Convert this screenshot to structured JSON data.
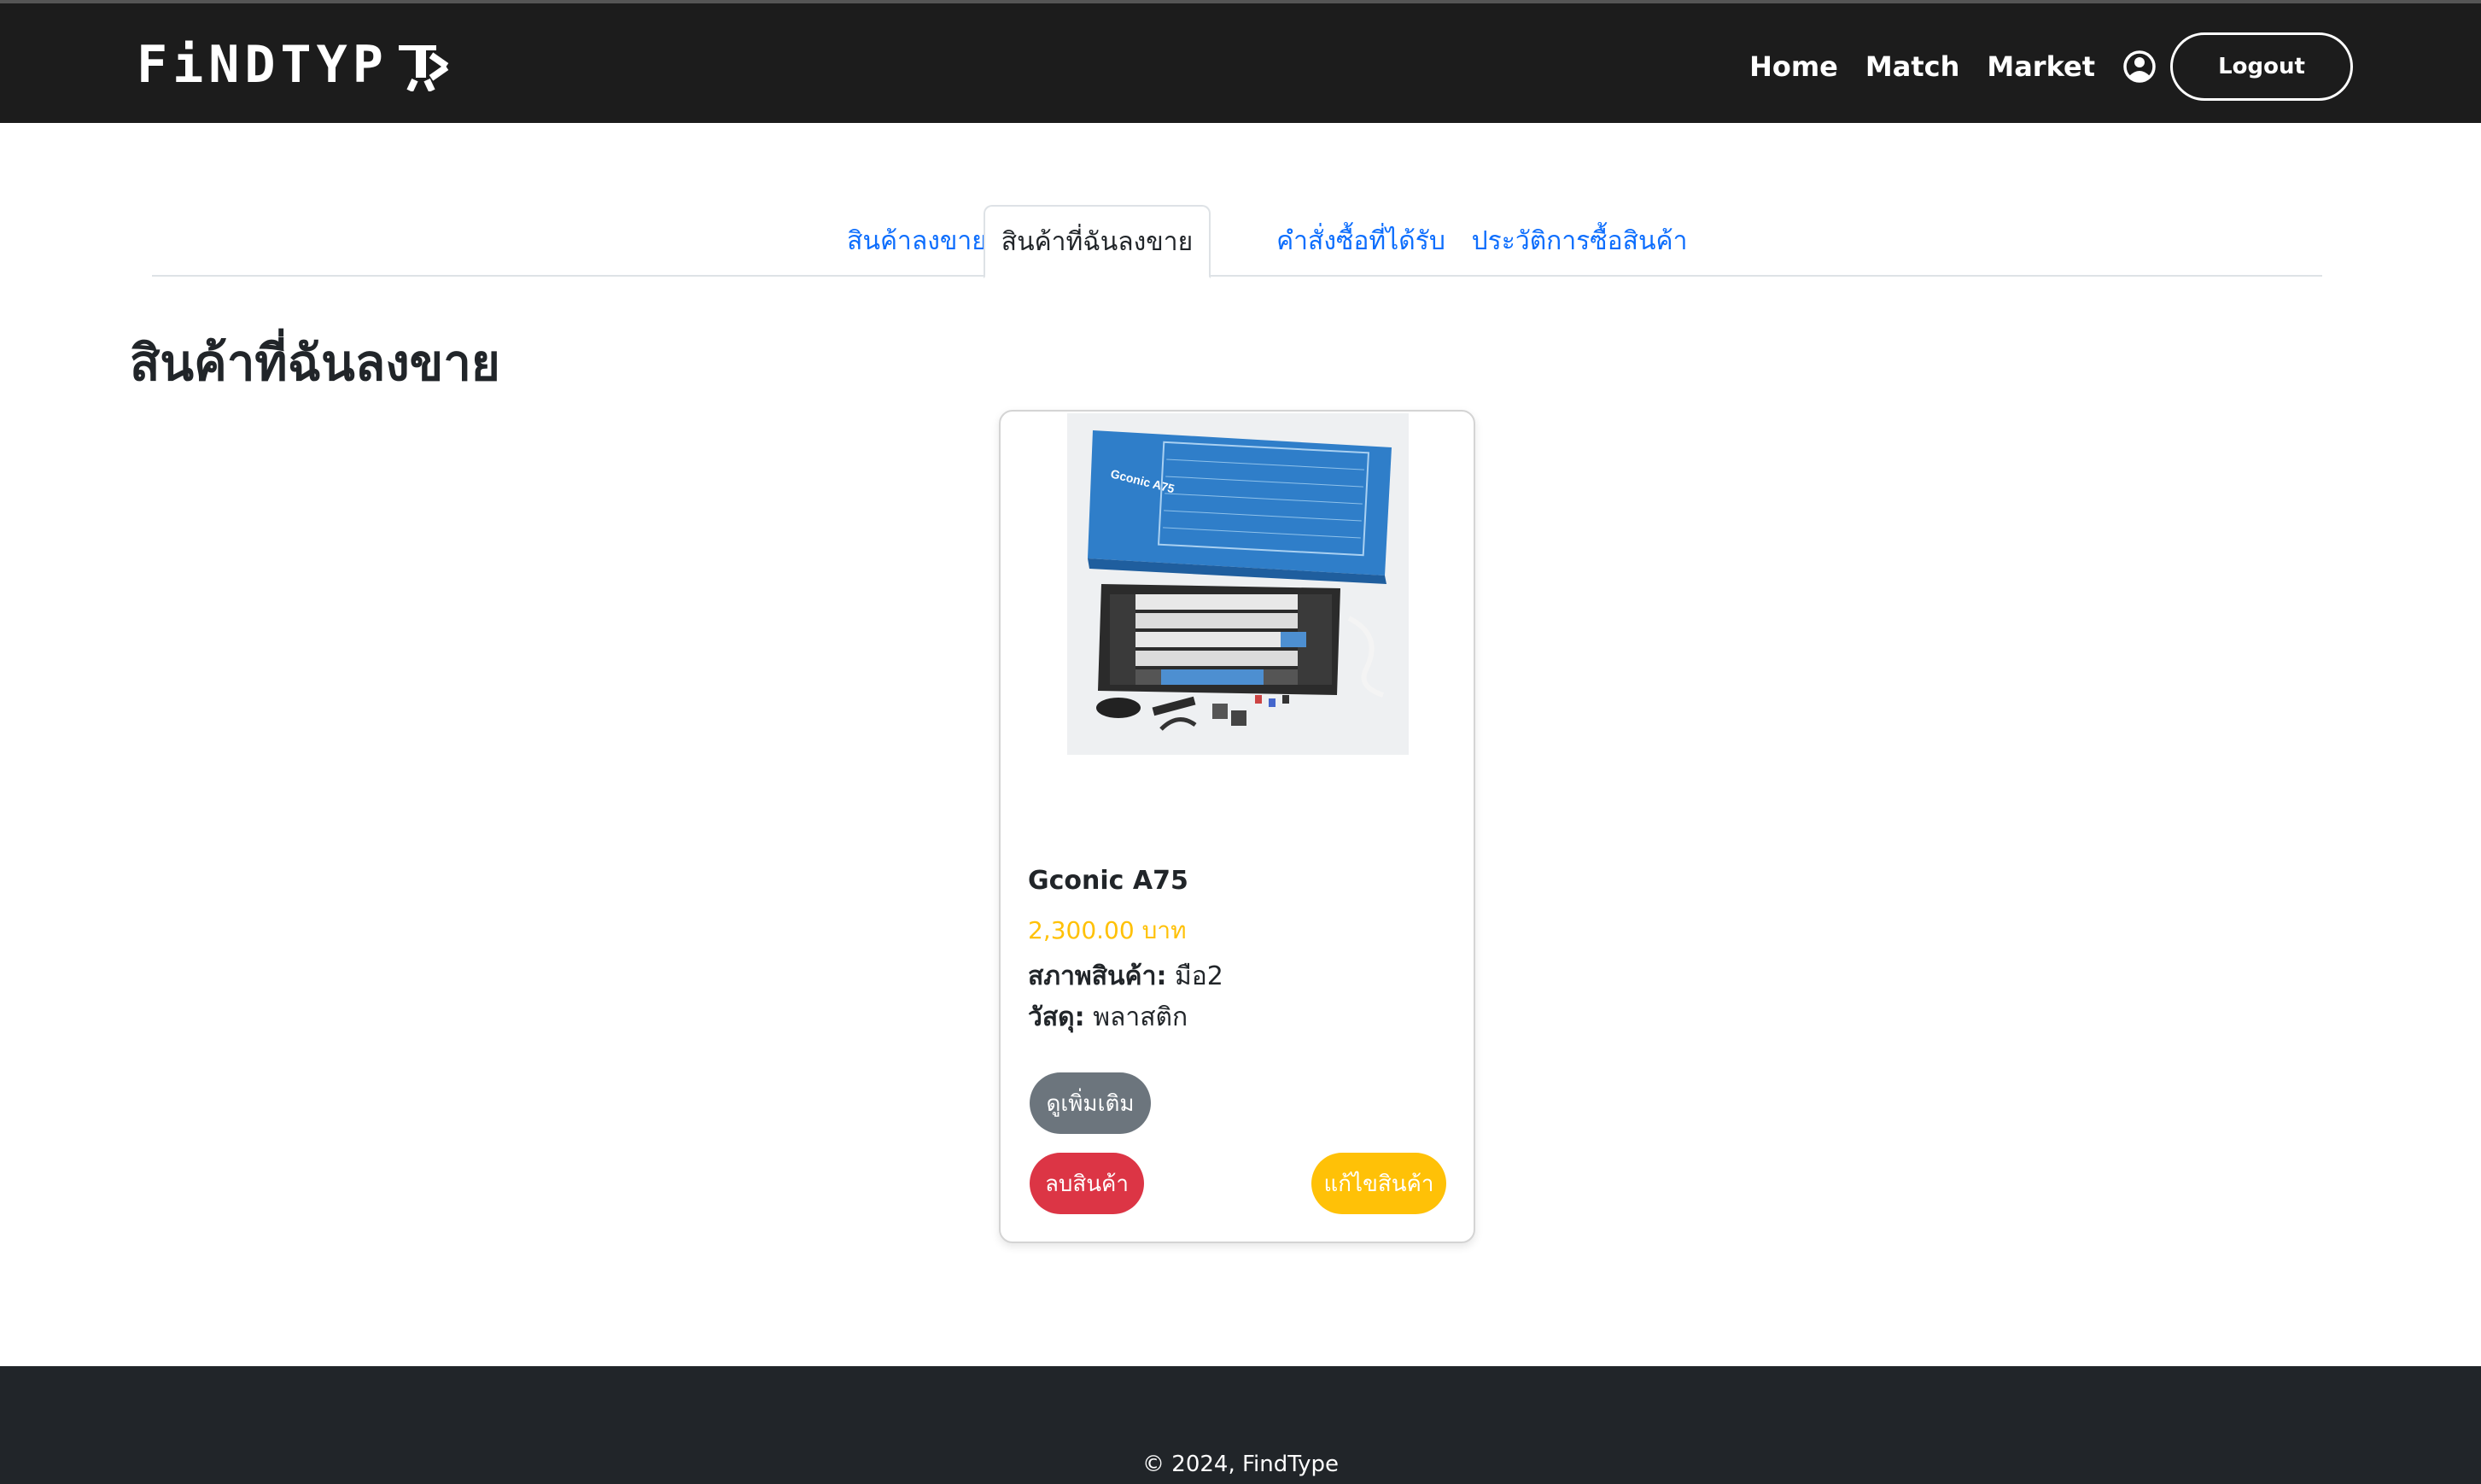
{
  "navbar": {
    "brand": "FiNDTYP",
    "links": [
      "Home",
      "Match",
      "Market"
    ],
    "logout_label": "Logout"
  },
  "tabs": [
    {
      "label": "สินค้าลงขาย",
      "active": false
    },
    {
      "label": "สินค้าที่ฉันลงขาย",
      "active": true
    },
    {
      "label": "คำสั่งซื้อที่ได้รับ",
      "active": false
    },
    {
      "label": "ประวัติการซื้อสินค้า",
      "active": false
    }
  ],
  "page_title": "สินค้าที่ฉันลงขาย",
  "product": {
    "image_box_label": "Gconic A75",
    "name": "Gconic A75",
    "price": "2,300.00 บาท",
    "condition_label": "สภาพสินค้า:",
    "condition_value": "มือ2",
    "material_label": "วัสดุ:",
    "material_value": "พลาสติก",
    "more_label": "ดูเพิ่มเติม",
    "delete_label": "ลบสินค้า",
    "edit_label": "แก้ไขสินค้า"
  },
  "footer": {
    "text": "© 2024, FindType"
  },
  "colors": {
    "navbar_bg": "#1c1c1c",
    "footer_bg": "#212529",
    "tab_link": "#0d6efd",
    "price": "#ffc107",
    "btn_more": "#6c757d",
    "btn_delete": "#dc3545",
    "btn_edit": "#ffc107"
  }
}
